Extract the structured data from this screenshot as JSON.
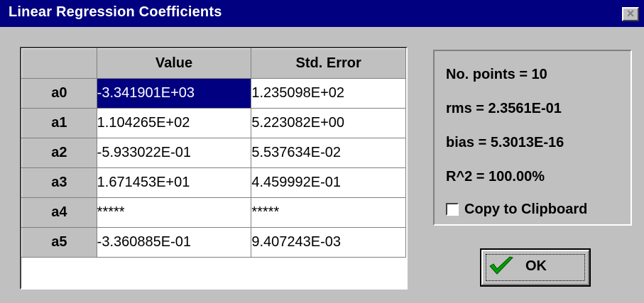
{
  "window": {
    "title": "Linear Regression Coefficients",
    "close_symbol": "×"
  },
  "table": {
    "columns": [
      "",
      "Value",
      "Std. Error"
    ],
    "rows": [
      {
        "name": "a0",
        "value": "-3.341901E+03",
        "std_error": "1.235098E+02",
        "selected": true
      },
      {
        "name": "a1",
        "value": "1.104265E+02",
        "std_error": "5.223082E+00"
      },
      {
        "name": "a2",
        "value": "-5.933022E-01",
        "std_error": "5.537634E-02"
      },
      {
        "name": "a3",
        "value": "1.671453E+01",
        "std_error": "4.459992E-01"
      },
      {
        "name": "a4",
        "value": "*****",
        "std_error": "*****"
      },
      {
        "name": "a5",
        "value": "-3.360885E-01",
        "std_error": "9.407243E-03"
      }
    ]
  },
  "stats": {
    "points": "No. points = 10",
    "rms": "rms = 2.3561E-01",
    "bias": "bias = 5.3013E-16",
    "r2": "R^2 = 100.00%"
  },
  "clipboard": {
    "label": "Copy to Clipboard",
    "checked": false
  },
  "ok_button": {
    "label": "OK",
    "icon": "checkmark-icon"
  },
  "colors": {
    "titlebar": "#000080",
    "selection": "#000080",
    "face": "#c0c0c0",
    "check_green": "#00a000"
  }
}
